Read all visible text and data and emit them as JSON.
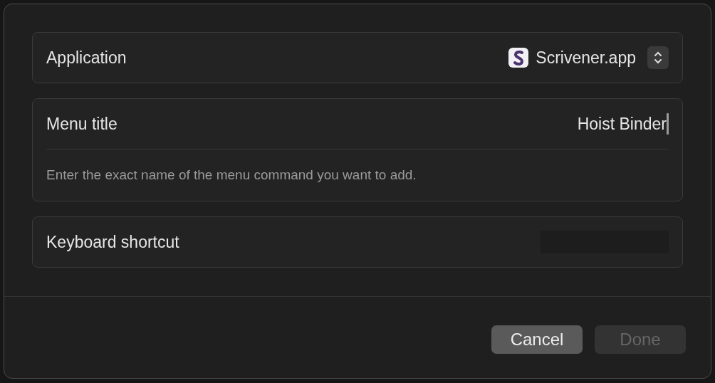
{
  "application": {
    "label": "Application",
    "value": "Scrivener.app"
  },
  "menu_title": {
    "label": "Menu title",
    "value": "Hoist Binder",
    "help": "Enter the exact name of the menu command you want to add."
  },
  "shortcut": {
    "label": "Keyboard shortcut"
  },
  "buttons": [
    {
      "label": "Cancel",
      "disabled": false
    },
    {
      "label": "Done",
      "disabled": true
    }
  ]
}
